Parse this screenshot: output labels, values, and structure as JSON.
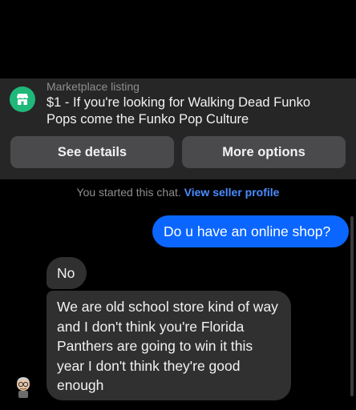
{
  "listing": {
    "kicker": "Marketplace listing",
    "title": "$1 - If you're looking for Walking Dead Funko Pops come the Funko Pop Culture",
    "icon": "marketplace-store-icon",
    "accent": "#20b87a"
  },
  "actions": {
    "see_details": "See details",
    "more_options": "More options"
  },
  "system": {
    "started_text": "You started this chat.",
    "seller_link": "View seller profile",
    "link_color": "#4a8cff"
  },
  "messages": [
    {
      "from": "me",
      "text": "Do u have an online shop?",
      "color": "#0a66ff"
    },
    {
      "from": "seller",
      "text": "No",
      "color": "#303030"
    },
    {
      "from": "seller",
      "text": "We are old school store kind of way and I don't think you're Florida Panthers are going to win it this year I don't think they're good enough",
      "color": "#303030"
    }
  ]
}
